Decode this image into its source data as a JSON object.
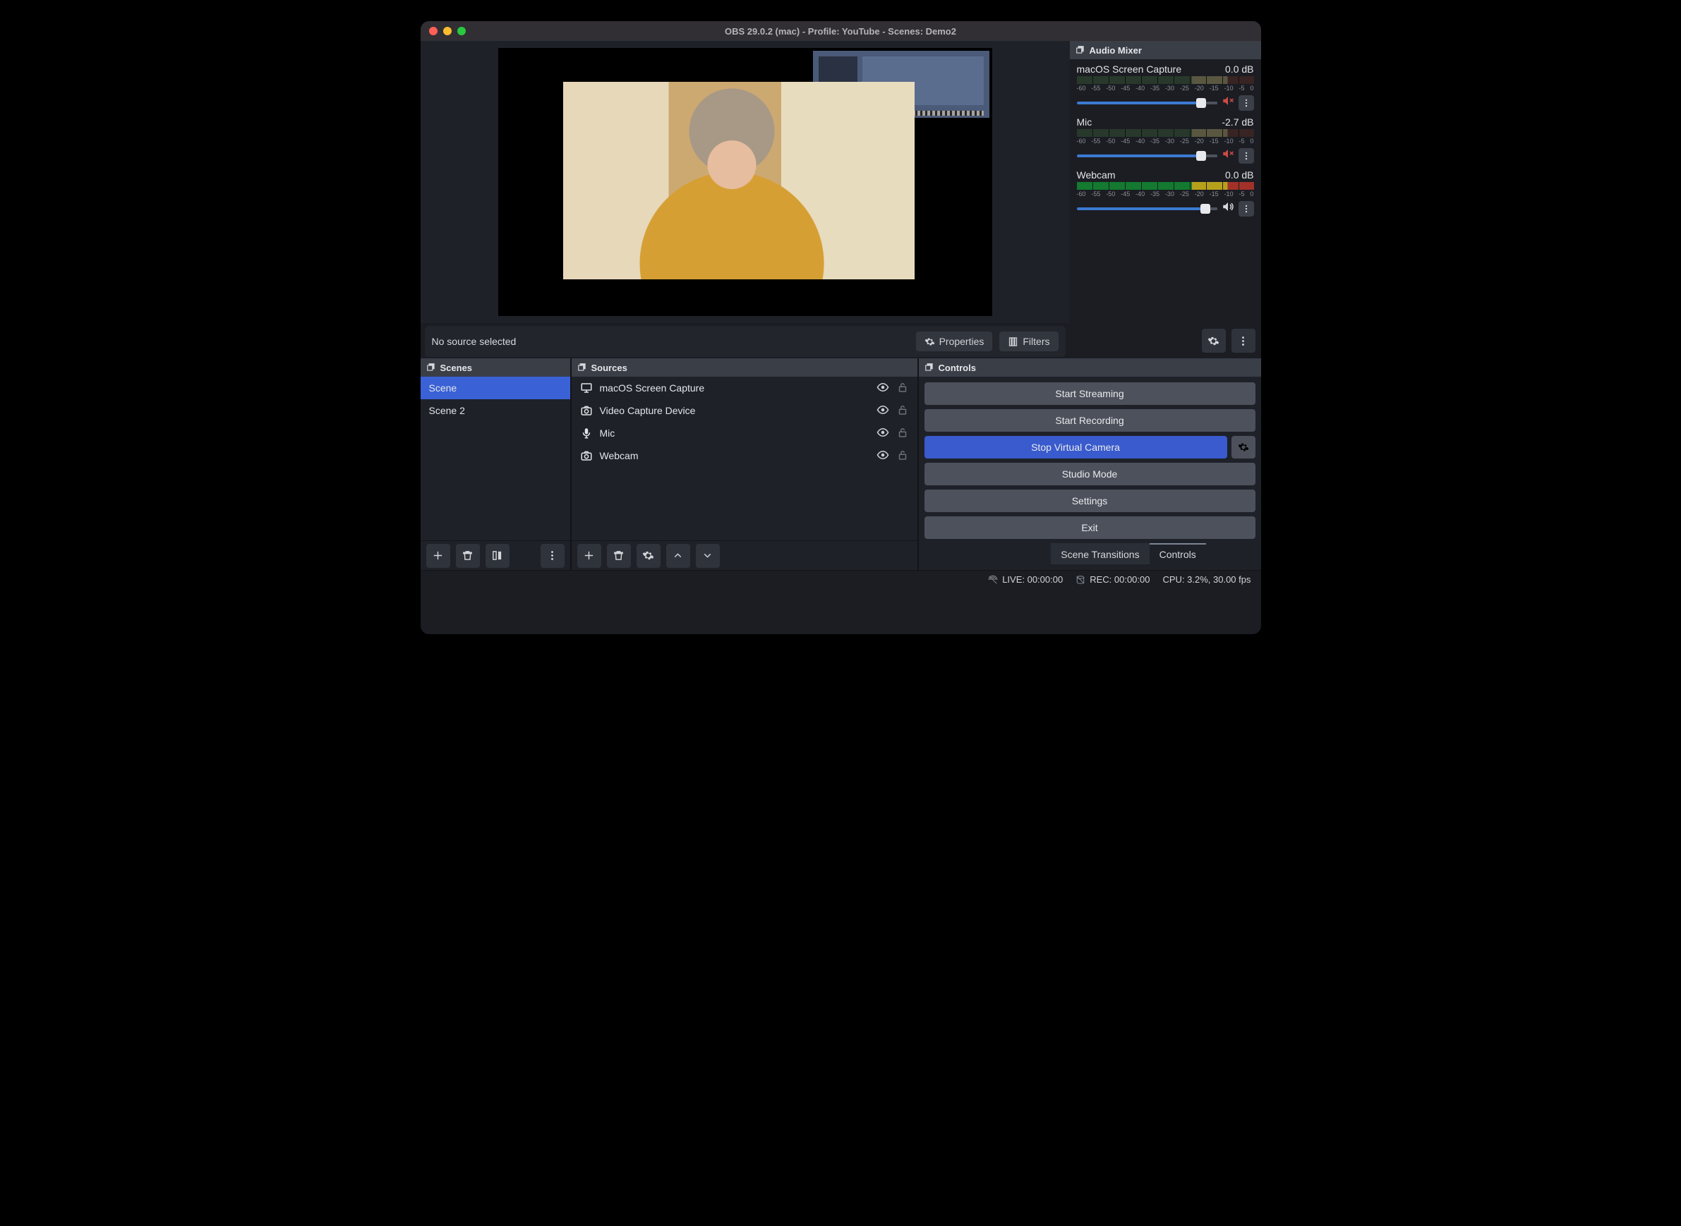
{
  "title": "OBS 29.0.2 (mac) - Profile: YouTube - Scenes: Demo2",
  "source_toolbar": {
    "message": "No source selected",
    "properties": "Properties",
    "filters": "Filters"
  },
  "mixer": {
    "title": "Audio Mixer",
    "scale": [
      "-60",
      "-55",
      "-50",
      "-45",
      "-40",
      "-35",
      "-30",
      "-25",
      "-20",
      "-15",
      "-10",
      "-5",
      "0"
    ],
    "channels": [
      {
        "name": "macOS Screen Capture",
        "db": "0.0 dB",
        "muted": true,
        "knob_pct": 85,
        "rest_pct": 13
      },
      {
        "name": "Mic",
        "db": "-2.7 dB",
        "muted": true,
        "knob_pct": 85,
        "rest_pct": 13
      },
      {
        "name": "Webcam",
        "db": "0.0 dB",
        "muted": false,
        "knob_pct": 88,
        "rest_pct": 10
      }
    ]
  },
  "scenes": {
    "title": "Scenes",
    "items": [
      {
        "label": "Scene",
        "active": true
      },
      {
        "label": "Scene 2",
        "active": false
      }
    ]
  },
  "sources": {
    "title": "Sources",
    "items": [
      {
        "label": "macOS Screen Capture",
        "icon": "monitor"
      },
      {
        "label": "Video Capture Device",
        "icon": "camera"
      },
      {
        "label": "Mic",
        "icon": "mic"
      },
      {
        "label": "Webcam",
        "icon": "camera"
      }
    ]
  },
  "controls": {
    "title": "Controls",
    "start_streaming": "Start Streaming",
    "start_recording": "Start Recording",
    "stop_virtual_camera": "Stop Virtual Camera",
    "studio_mode": "Studio Mode",
    "settings": "Settings",
    "exit": "Exit",
    "tab_transitions": "Scene Transitions",
    "tab_controls": "Controls"
  },
  "status": {
    "live": "LIVE: 00:00:00",
    "rec": "REC: 00:00:00",
    "cpu": "CPU: 3.2%, 30.00 fps"
  }
}
